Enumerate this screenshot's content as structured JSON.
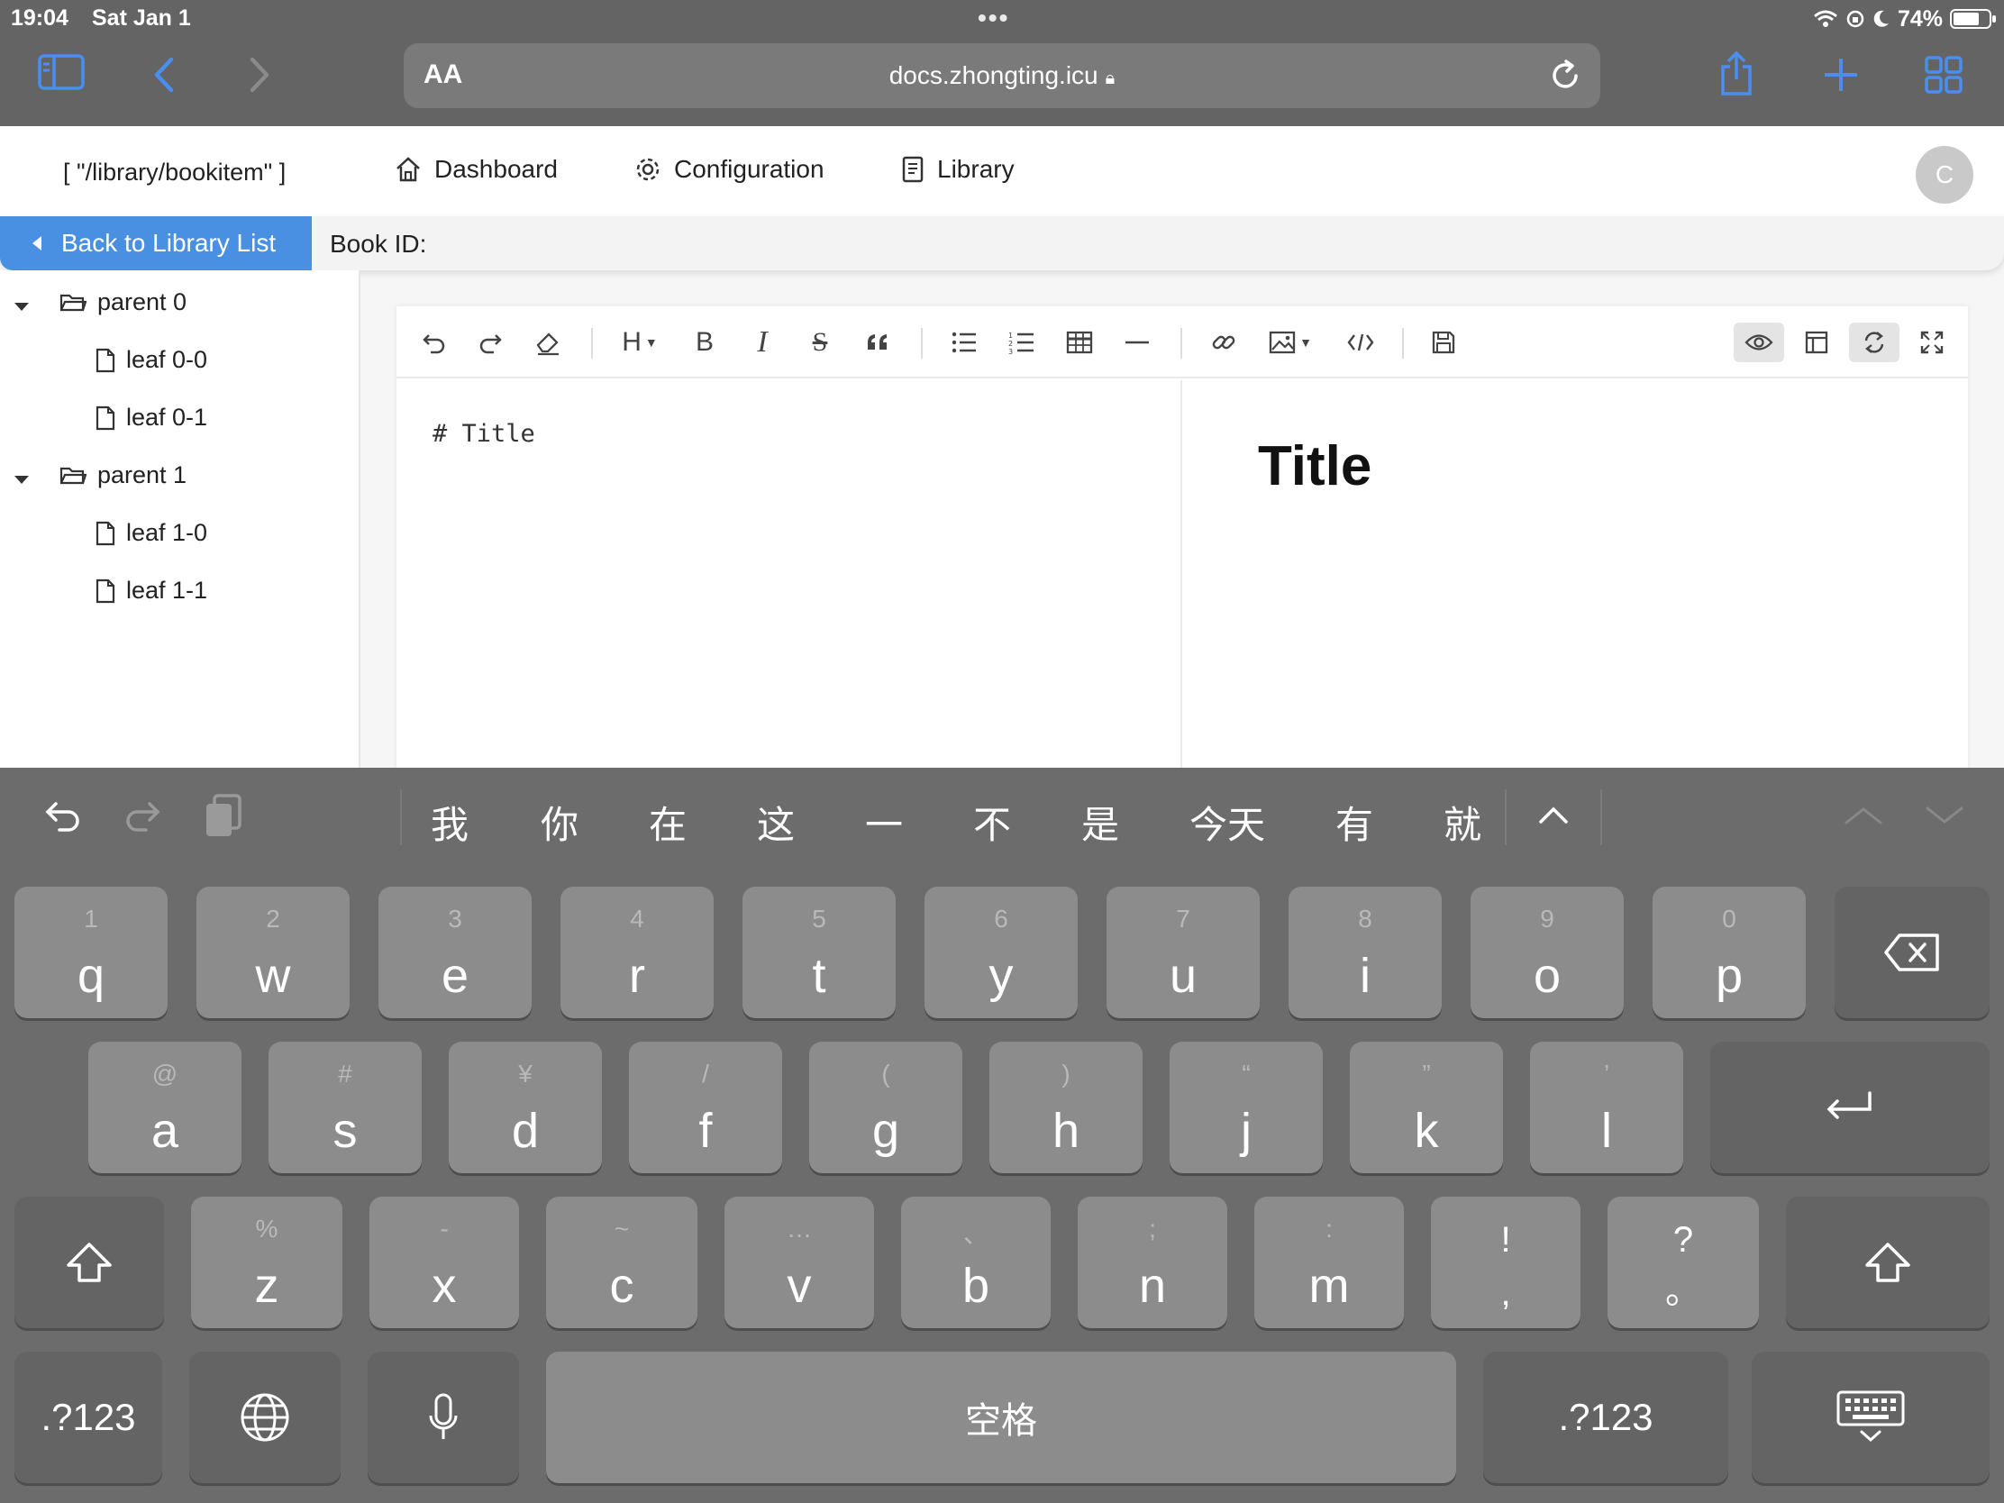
{
  "status": {
    "time": "19:04",
    "date": "Sat Jan 1",
    "battery_percent": "74%",
    "battery_level": 0.74
  },
  "browser": {
    "url_size_label": "AA",
    "url": "docs.zhongting.icu"
  },
  "app": {
    "route": "[ \"/library/bookitem\" ]",
    "nav": [
      {
        "label": "Dashboard",
        "icon": "home-icon"
      },
      {
        "label": "Configuration",
        "icon": "gear-icon"
      },
      {
        "label": "Library",
        "icon": "book-icon"
      }
    ],
    "avatar_initial": "C",
    "back_button": "Back to Library List",
    "book_id_label": "Book ID:"
  },
  "tree": [
    {
      "label": "parent 0",
      "type": "folder"
    },
    {
      "label": "leaf 0-0",
      "type": "file"
    },
    {
      "label": "leaf 0-1",
      "type": "file"
    },
    {
      "label": "parent 1",
      "type": "folder"
    },
    {
      "label": "leaf 1-0",
      "type": "file"
    },
    {
      "label": "leaf 1-1",
      "type": "file"
    }
  ],
  "editor": {
    "source": "# Title",
    "preview_title": "Title",
    "heading_label": "H",
    "bold_label": "B",
    "italic_label": "I",
    "strike_label": "S"
  },
  "keyboard": {
    "candidates": [
      "我",
      "你",
      "在",
      "这",
      "一",
      "不",
      "是",
      "今天",
      "有",
      "就"
    ],
    "row1": [
      {
        "hint": "1",
        "key": "q"
      },
      {
        "hint": "2",
        "key": "w"
      },
      {
        "hint": "3",
        "key": "e"
      },
      {
        "hint": "4",
        "key": "r"
      },
      {
        "hint": "5",
        "key": "t"
      },
      {
        "hint": "6",
        "key": "y"
      },
      {
        "hint": "7",
        "key": "u"
      },
      {
        "hint": "8",
        "key": "i"
      },
      {
        "hint": "9",
        "key": "o"
      },
      {
        "hint": "0",
        "key": "p"
      }
    ],
    "row2": [
      {
        "hint": "@",
        "key": "a"
      },
      {
        "hint": "#",
        "key": "s"
      },
      {
        "hint": "¥",
        "key": "d"
      },
      {
        "hint": "/",
        "key": "f"
      },
      {
        "hint": "(",
        "key": "g"
      },
      {
        "hint": ")",
        "key": "h"
      },
      {
        "hint": "“",
        "key": "j"
      },
      {
        "hint": "”",
        "key": "k"
      },
      {
        "hint": "’",
        "key": "l"
      }
    ],
    "row3": [
      {
        "hint": "%",
        "key": "z"
      },
      {
        "hint": "-",
        "key": "x"
      },
      {
        "hint": "~",
        "key": "c"
      },
      {
        "hint": "…",
        "key": "v"
      },
      {
        "hint": "、",
        "key": "b"
      },
      {
        "hint": ";",
        "key": "n"
      },
      {
        "hint": ":",
        "key": "m"
      },
      {
        "hint": "!",
        "key": ","
      },
      {
        "hint": "?",
        "key": "。"
      }
    ],
    "numbers_label": ".?123",
    "space_label": "空格"
  }
}
